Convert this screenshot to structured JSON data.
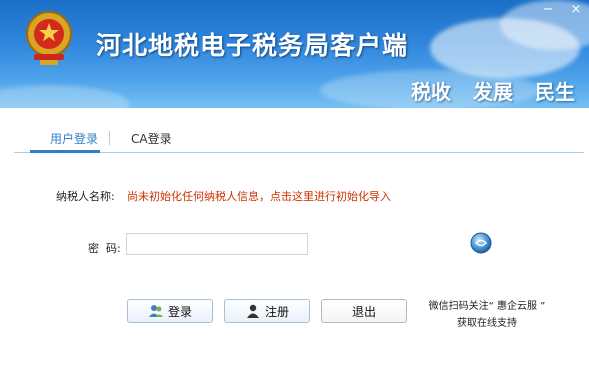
{
  "header": {
    "title": "河北地税电子税务局客户端",
    "slogans": [
      "税收",
      "发展",
      "民生"
    ],
    "window_controls": [
      "−",
      "×"
    ]
  },
  "tabs": {
    "user_login": "用户登录",
    "ca_login": "CA登录"
  },
  "form": {
    "taxpayer_label": "纳税人名称:",
    "taxpayer_message": "尚未初始化任何纳税人信息，点击这里进行初始化导入",
    "password_label": "密  码:",
    "password_value": ""
  },
  "buttons": {
    "login": "登录",
    "register": "注册",
    "exit": "退出"
  },
  "support": {
    "line1": "微信扫码关注“ 惠企云服 ”",
    "line2": "获取在线支持"
  },
  "colors": {
    "header_blue": "#2f86dc",
    "tab_active": "#2f7fc6",
    "warning_text": "#cc3300"
  }
}
